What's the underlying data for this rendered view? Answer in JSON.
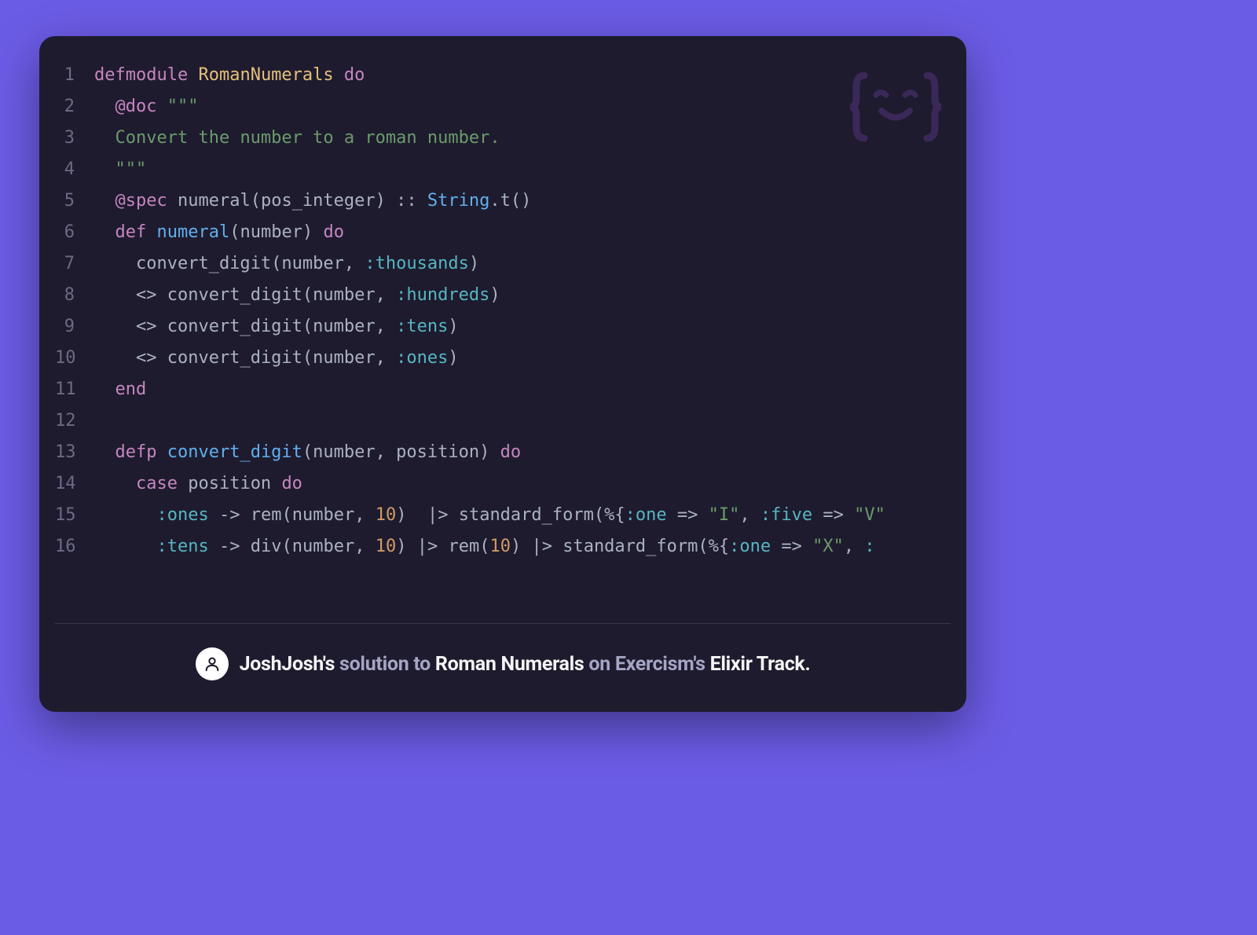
{
  "code": {
    "lines": [
      {
        "n": 1,
        "tokens": [
          [
            "keyword",
            "defmodule"
          ],
          [
            "plain",
            " "
          ],
          [
            "module",
            "RomanNumerals"
          ],
          [
            "plain",
            " "
          ],
          [
            "keyword",
            "do"
          ]
        ]
      },
      {
        "n": 2,
        "tokens": [
          [
            "plain",
            "  "
          ],
          [
            "attr",
            "@doc"
          ],
          [
            "plain",
            " "
          ],
          [
            "string",
            "\"\"\""
          ]
        ]
      },
      {
        "n": 3,
        "tokens": [
          [
            "plain",
            "  "
          ],
          [
            "string",
            "Convert the number to a roman number."
          ]
        ]
      },
      {
        "n": 4,
        "tokens": [
          [
            "plain",
            "  "
          ],
          [
            "string",
            "\"\"\""
          ]
        ]
      },
      {
        "n": 5,
        "tokens": [
          [
            "plain",
            "  "
          ],
          [
            "attr",
            "@spec"
          ],
          [
            "plain",
            " "
          ],
          [
            "var",
            "numeral"
          ],
          [
            "paren",
            "("
          ],
          [
            "var",
            "pos_integer"
          ],
          [
            "paren",
            ")"
          ],
          [
            "plain",
            " "
          ],
          [
            "op",
            "::"
          ],
          [
            "plain",
            " "
          ],
          [
            "type",
            "String"
          ],
          [
            "op",
            "."
          ],
          [
            "var",
            "t"
          ],
          [
            "paren",
            "()"
          ]
        ]
      },
      {
        "n": 6,
        "tokens": [
          [
            "plain",
            "  "
          ],
          [
            "keyword",
            "def"
          ],
          [
            "plain",
            " "
          ],
          [
            "func",
            "numeral"
          ],
          [
            "paren",
            "("
          ],
          [
            "var",
            "number"
          ],
          [
            "paren",
            ")"
          ],
          [
            "plain",
            " "
          ],
          [
            "keyword",
            "do"
          ]
        ]
      },
      {
        "n": 7,
        "tokens": [
          [
            "plain",
            "    "
          ],
          [
            "var",
            "convert_digit"
          ],
          [
            "paren",
            "("
          ],
          [
            "var",
            "number"
          ],
          [
            "op",
            ","
          ],
          [
            "plain",
            " "
          ],
          [
            "atom",
            ":thousands"
          ],
          [
            "paren",
            ")"
          ]
        ]
      },
      {
        "n": 8,
        "tokens": [
          [
            "plain",
            "    "
          ],
          [
            "op",
            "<>"
          ],
          [
            "plain",
            " "
          ],
          [
            "var",
            "convert_digit"
          ],
          [
            "paren",
            "("
          ],
          [
            "var",
            "number"
          ],
          [
            "op",
            ","
          ],
          [
            "plain",
            " "
          ],
          [
            "atom",
            ":hundreds"
          ],
          [
            "paren",
            ")"
          ]
        ]
      },
      {
        "n": 9,
        "tokens": [
          [
            "plain",
            "    "
          ],
          [
            "op",
            "<>"
          ],
          [
            "plain",
            " "
          ],
          [
            "var",
            "convert_digit"
          ],
          [
            "paren",
            "("
          ],
          [
            "var",
            "number"
          ],
          [
            "op",
            ","
          ],
          [
            "plain",
            " "
          ],
          [
            "atom",
            ":tens"
          ],
          [
            "paren",
            ")"
          ]
        ]
      },
      {
        "n": 10,
        "tokens": [
          [
            "plain",
            "    "
          ],
          [
            "op",
            "<>"
          ],
          [
            "plain",
            " "
          ],
          [
            "var",
            "convert_digit"
          ],
          [
            "paren",
            "("
          ],
          [
            "var",
            "number"
          ],
          [
            "op",
            ","
          ],
          [
            "plain",
            " "
          ],
          [
            "atom",
            ":ones"
          ],
          [
            "paren",
            ")"
          ]
        ]
      },
      {
        "n": 11,
        "tokens": [
          [
            "plain",
            "  "
          ],
          [
            "keyword",
            "end"
          ]
        ]
      },
      {
        "n": 12,
        "tokens": [
          [
            "plain",
            ""
          ]
        ]
      },
      {
        "n": 13,
        "tokens": [
          [
            "plain",
            "  "
          ],
          [
            "keyword",
            "defp"
          ],
          [
            "plain",
            " "
          ],
          [
            "func",
            "convert_digit"
          ],
          [
            "paren",
            "("
          ],
          [
            "var",
            "number"
          ],
          [
            "op",
            ","
          ],
          [
            "plain",
            " "
          ],
          [
            "var",
            "position"
          ],
          [
            "paren",
            ")"
          ],
          [
            "plain",
            " "
          ],
          [
            "keyword",
            "do"
          ]
        ]
      },
      {
        "n": 14,
        "tokens": [
          [
            "plain",
            "    "
          ],
          [
            "keyword",
            "case"
          ],
          [
            "plain",
            " "
          ],
          [
            "var",
            "position"
          ],
          [
            "plain",
            " "
          ],
          [
            "keyword",
            "do"
          ]
        ]
      },
      {
        "n": 15,
        "tokens": [
          [
            "plain",
            "      "
          ],
          [
            "atom",
            ":ones"
          ],
          [
            "plain",
            " "
          ],
          [
            "op",
            "->"
          ],
          [
            "plain",
            " "
          ],
          [
            "var",
            "rem"
          ],
          [
            "paren",
            "("
          ],
          [
            "var",
            "number"
          ],
          [
            "op",
            ","
          ],
          [
            "plain",
            " "
          ],
          [
            "num",
            "10"
          ],
          [
            "paren",
            ")"
          ],
          [
            "plain",
            "  "
          ],
          [
            "op",
            "|>"
          ],
          [
            "plain",
            " "
          ],
          [
            "var",
            "standard_form"
          ],
          [
            "paren",
            "("
          ],
          [
            "op",
            "%{"
          ],
          [
            "atom",
            ":one"
          ],
          [
            "plain",
            " "
          ],
          [
            "op",
            "=>"
          ],
          [
            "plain",
            " "
          ],
          [
            "string",
            "\"I\""
          ],
          [
            "op",
            ","
          ],
          [
            "plain",
            " "
          ],
          [
            "atom",
            ":five"
          ],
          [
            "plain",
            " "
          ],
          [
            "op",
            "=>"
          ],
          [
            "plain",
            " "
          ],
          [
            "string",
            "\"V\""
          ]
        ]
      },
      {
        "n": 16,
        "tokens": [
          [
            "plain",
            "      "
          ],
          [
            "atom",
            ":tens"
          ],
          [
            "plain",
            " "
          ],
          [
            "op",
            "->"
          ],
          [
            "plain",
            " "
          ],
          [
            "var",
            "div"
          ],
          [
            "paren",
            "("
          ],
          [
            "var",
            "number"
          ],
          [
            "op",
            ","
          ],
          [
            "plain",
            " "
          ],
          [
            "num",
            "10"
          ],
          [
            "paren",
            ")"
          ],
          [
            "plain",
            " "
          ],
          [
            "op",
            "|>"
          ],
          [
            "plain",
            " "
          ],
          [
            "var",
            "rem"
          ],
          [
            "paren",
            "("
          ],
          [
            "num",
            "10"
          ],
          [
            "paren",
            ")"
          ],
          [
            "plain",
            " "
          ],
          [
            "op",
            "|>"
          ],
          [
            "plain",
            " "
          ],
          [
            "var",
            "standard_form"
          ],
          [
            "paren",
            "("
          ],
          [
            "op",
            "%{"
          ],
          [
            "atom",
            ":one"
          ],
          [
            "plain",
            " "
          ],
          [
            "op",
            "=>"
          ],
          [
            "plain",
            " "
          ],
          [
            "string",
            "\"X\""
          ],
          [
            "op",
            ","
          ],
          [
            "plain",
            " "
          ],
          [
            "atom",
            ":"
          ]
        ]
      }
    ]
  },
  "footer": {
    "user": "JoshJosh's",
    "mid1": " solution to ",
    "exercise": "Roman Numerals",
    "mid2": " on Exercism's ",
    "track": "Elixir Track."
  }
}
